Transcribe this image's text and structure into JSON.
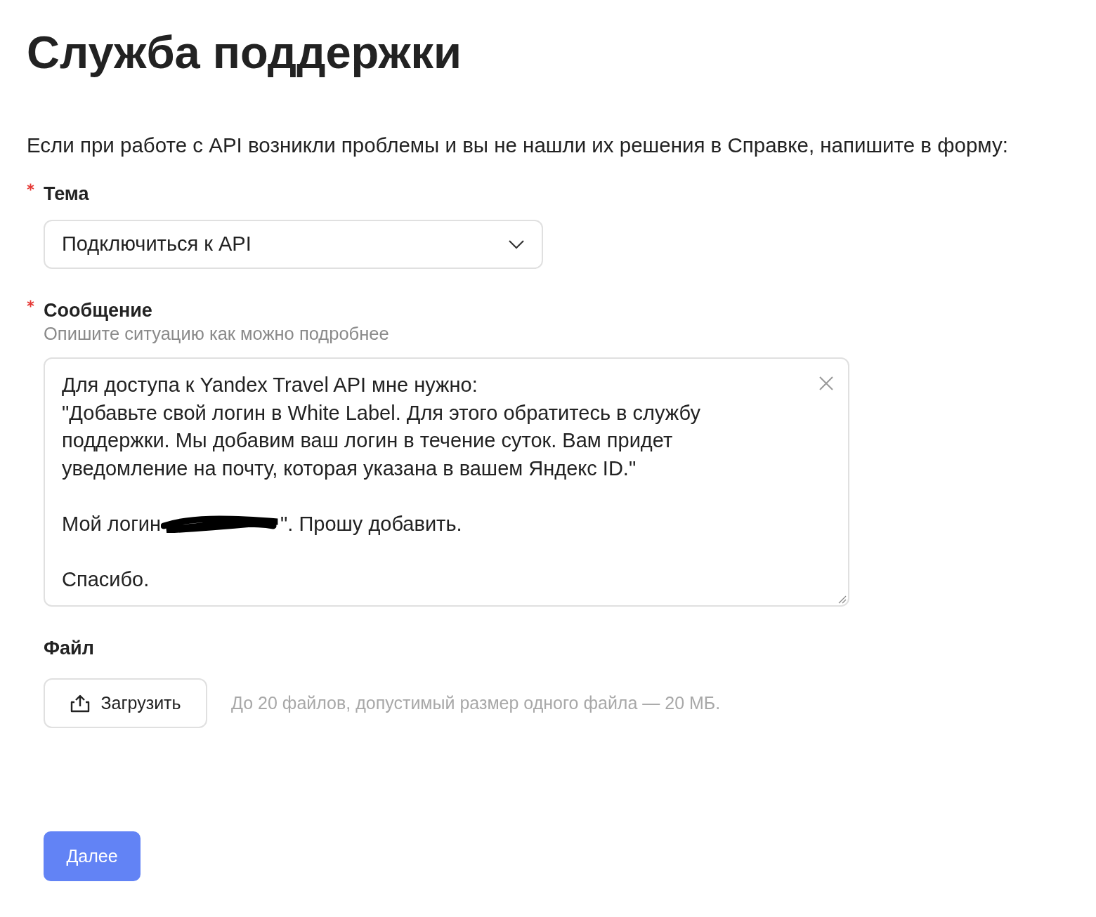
{
  "title": "Служба поддержки",
  "intro": "Если при работе с API возникли проблемы и вы не нашли их решения в Справке, напишите в форму:",
  "topic": {
    "label": "Тема",
    "required": true,
    "value": "Подключиться к API"
  },
  "message": {
    "label": "Сообщение",
    "required": true,
    "hint": "Опишите ситуацию как можно подробнее",
    "lines": [
      {
        "kind": "text",
        "text": "Для доступа к Yandex Travel API мне нужно:"
      },
      {
        "kind": "text",
        "text": "\"Добавьте свой логин в White Label. Для этого обратитесь в службу"
      },
      {
        "kind": "text",
        "text": "поддержки. Мы добавим ваш логин в течение суток. Вам придет"
      },
      {
        "kind": "text",
        "text": "уведомление на почту, которая указана в вашем Яндекс ID.\""
      },
      {
        "kind": "blank"
      },
      {
        "kind": "redacted",
        "before": "Мой логин",
        "after": "\". Прошу добавить."
      },
      {
        "kind": "blank"
      },
      {
        "kind": "text",
        "text": "Спасибо."
      }
    ]
  },
  "file": {
    "label": "Файл",
    "button": "Загрузить",
    "note": "До 20 файлов, допустимый размер одного файла — 20 МБ."
  },
  "submit": "Далее"
}
